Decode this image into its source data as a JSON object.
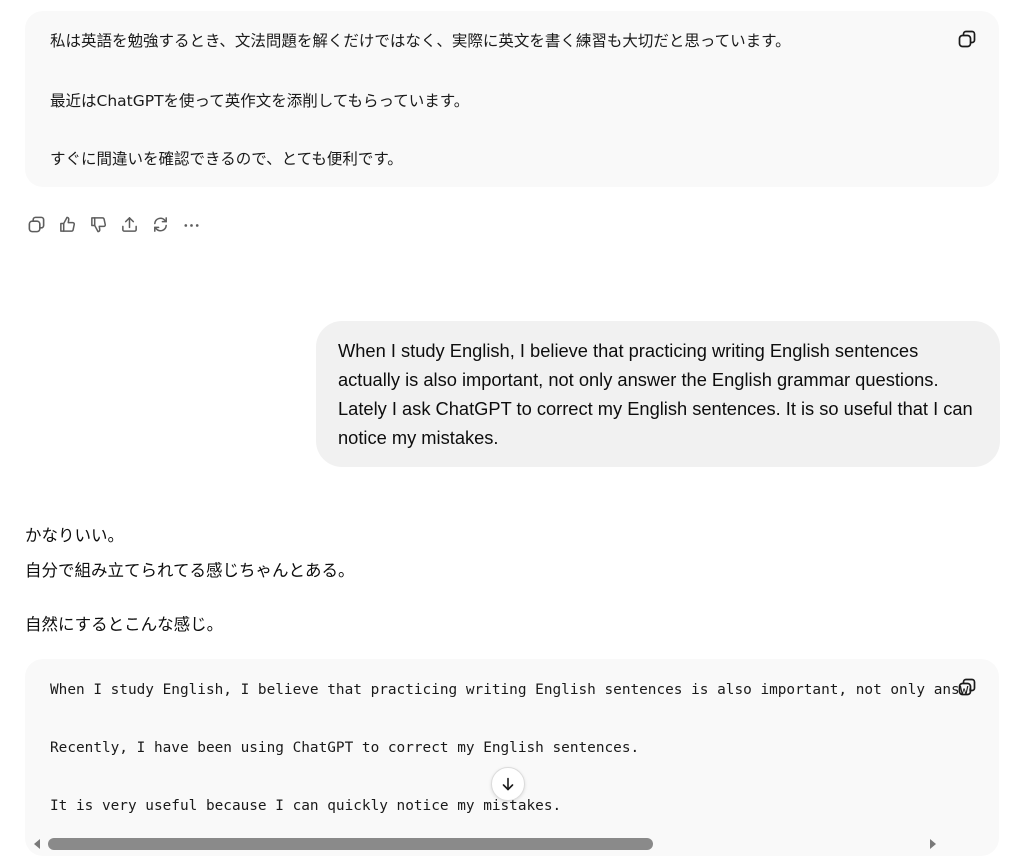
{
  "conversation": {
    "top_code_block": {
      "lines": [
        "私は英語を勉強するとき、文法問題を解くだけではなく、実際に英文を書く練習も大切だと思っています。",
        "最近はChatGPTを使って英作文を添削してもらっています。",
        "すぐに間違いを確認できるので、とても便利です。"
      ],
      "copy_icon": "copy-icon"
    },
    "action_bar": {
      "icons": [
        "copy-icon",
        "thumbs-up-icon",
        "thumbs-down-icon",
        "share-icon",
        "regenerate-icon",
        "more-icon"
      ]
    },
    "user_message": {
      "text": "When I study English, I believe that practicing writing English sentences actually is also important, not only answer the English grammar questions. Lately I ask ChatGPT to correct my English sentences. It is so useful that I can notice my mistakes."
    },
    "assistant_message": {
      "line1": "かなりいい。",
      "line2": "自分で組み立てられてる感じちゃんとある。",
      "line3": "自然にするとこんな感じ。"
    },
    "bottom_code_block": {
      "lines": [
        "When I study English, I believe that practicing writing English sentences is also important, not only answering grammar questions.",
        "Recently, I have been using ChatGPT to correct my English sentences.",
        "It is very useful because I can quickly notice my mistakes."
      ],
      "copy_icon": "copy-icon"
    },
    "scroll_down_icon": "arrow-down-icon"
  },
  "colors": {
    "code_bg": "#f9f9f9",
    "bubble_bg": "#f1f1f1",
    "icon": "#5d5d5d",
    "scrollbar_thumb": "#8a8a8a"
  }
}
